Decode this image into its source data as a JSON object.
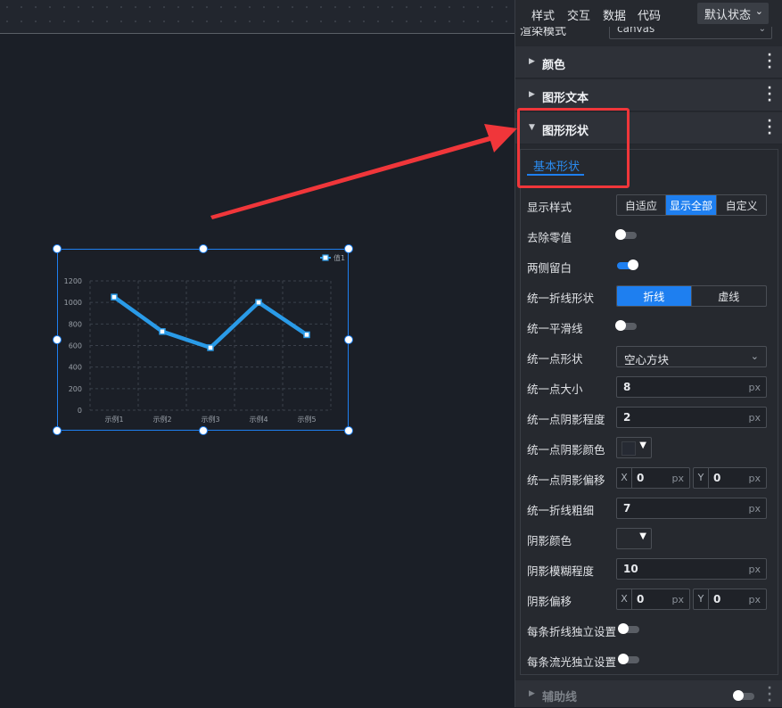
{
  "panel": {
    "tabs": [
      "样式",
      "交互",
      "数据",
      "代码"
    ],
    "state_select": "默认状态",
    "render_mode": {
      "label": "渲染模式",
      "value": "canvas"
    },
    "sections": {
      "color": "颜色",
      "shape_text": "图形文本",
      "shape_form": "图形形状",
      "aux_line": "辅助线"
    },
    "basic_tab": "基本形状",
    "fields": {
      "display_style": {
        "label": "显示样式",
        "options": [
          "自适应",
          "显示全部",
          "自定义"
        ],
        "selected": "显示全部"
      },
      "remove_zero": {
        "label": "去除零值",
        "on": false
      },
      "both_margin": {
        "label": "两侧留白",
        "on": true
      },
      "line_shape": {
        "label": "统一折线形状",
        "options": [
          "折线",
          "虚线"
        ],
        "selected": "折线"
      },
      "smooth": {
        "label": "统一平滑线",
        "on": false
      },
      "point_shape": {
        "label": "统一点形状",
        "value": "空心方块"
      },
      "point_size": {
        "label": "统一点大小",
        "value": "8",
        "unit": "px"
      },
      "point_shadow_blur": {
        "label": "统一点阴影程度",
        "value": "2",
        "unit": "px"
      },
      "point_shadow_color": {
        "label": "统一点阴影颜色"
      },
      "point_shadow_offset": {
        "label": "统一点阴影偏移",
        "x": "0",
        "y": "0",
        "unit": "px",
        "x_prefix": "X",
        "y_prefix": "Y"
      },
      "line_width": {
        "label": "统一折线粗细",
        "value": "7",
        "unit": "px"
      },
      "shadow_color": {
        "label": "阴影颜色"
      },
      "shadow_blur": {
        "label": "阴影模糊程度",
        "value": "10",
        "unit": "px"
      },
      "shadow_offset": {
        "label": "阴影偏移",
        "x": "0",
        "y": "0",
        "unit": "px",
        "x_prefix": "X",
        "y_prefix": "Y"
      },
      "per_line": {
        "label": "每条折线独立设置",
        "on": false
      },
      "per_flow": {
        "label": "每条流光独立设置",
        "on": false
      }
    }
  },
  "colors": {
    "accent": "#1e7ff0",
    "highlight": "#f0363a",
    "series": "#2a9be8"
  },
  "chart_data": {
    "type": "line",
    "categories": [
      "示例1",
      "示例2",
      "示例3",
      "示例4",
      "示例5"
    ],
    "series": [
      {
        "name": "值1",
        "values": [
          1050,
          730,
          580,
          1000,
          700
        ]
      }
    ],
    "ylim": [
      0,
      1200
    ],
    "yticks": [
      0,
      200,
      400,
      600,
      800,
      1000,
      1200
    ],
    "grid": true,
    "legend": "top-right"
  }
}
